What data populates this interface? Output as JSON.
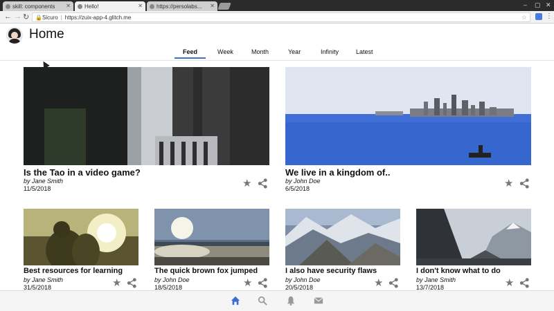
{
  "browser": {
    "tabs": [
      {
        "label": "skill: components"
      },
      {
        "label": "Hello!"
      },
      {
        "label": "https://persolabs..."
      }
    ],
    "secure_label": "Sicuro",
    "url": "https://zuix-app-4.glitch.me"
  },
  "app": {
    "title": "Home",
    "nav_tabs": [
      {
        "label": "Feed",
        "active": true
      },
      {
        "label": "Week",
        "active": false
      },
      {
        "label": "Month",
        "active": false
      },
      {
        "label": "Year",
        "active": false
      },
      {
        "label": "Infinity",
        "active": false
      },
      {
        "label": "Latest",
        "active": false
      }
    ]
  },
  "featured": [
    {
      "title": "Is the Tao in a video game?",
      "author": "by Jane Smith",
      "date": "11/5/2018",
      "image": "dark-room-curtain"
    },
    {
      "title": "We live in a kingdom of..",
      "author": "by John Doe",
      "date": "6/5/2018",
      "image": "city-skyline-bay"
    }
  ],
  "cards": [
    {
      "title": "Best resources for learning",
      "author": "by Jane Smith",
      "date": "31/5/2018",
      "image": "couple-sunset"
    },
    {
      "title": "The quick brown fox jumped",
      "author": "by John Doe",
      "date": "18/5/2018",
      "image": "sun-over-lake"
    },
    {
      "title": "I also have security flaws",
      "author": "by John Doe",
      "date": "20/5/2018",
      "image": "snowy-mountains"
    },
    {
      "title": "I don't know what to do",
      "author": "by Jane Smith",
      "date": "13/7/2018",
      "image": "mountain-valley"
    }
  ],
  "bottom_nav": [
    {
      "icon": "home-icon",
      "active": true
    },
    {
      "icon": "search-icon",
      "active": false
    },
    {
      "icon": "bell-icon",
      "active": false
    },
    {
      "icon": "mail-icon",
      "active": false
    }
  ],
  "colors": {
    "accent": "#3b6fd1",
    "icon_gray": "#777777"
  }
}
